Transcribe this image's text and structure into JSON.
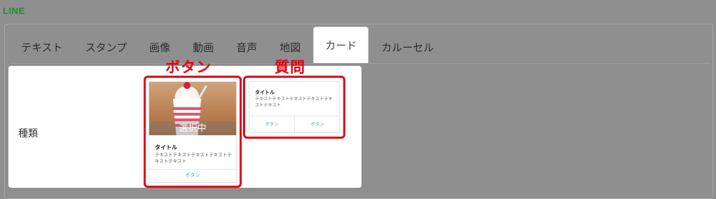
{
  "app": {
    "brand": "LINE"
  },
  "tabs": [
    {
      "label": "テキスト",
      "active": false
    },
    {
      "label": "スタンプ",
      "active": false
    },
    {
      "label": "画像",
      "active": false
    },
    {
      "label": "動画",
      "active": false
    },
    {
      "label": "音声",
      "active": false
    },
    {
      "label": "地図",
      "active": false
    },
    {
      "label": "カード",
      "active": true
    },
    {
      "label": "カルーセル",
      "active": false
    }
  ],
  "form": {
    "type_label": "種類"
  },
  "annotations": {
    "button": "ボタン",
    "question": "質問"
  },
  "button_card": {
    "selected_label": "選択中",
    "title": "タイトル",
    "body": "テキストテキストテキストテキストテキストテキスト",
    "button_label": "ボタン"
  },
  "question_card": {
    "title": "タイトル",
    "body": "テキストテキストテキストテキストテキストテキスト",
    "button_left": "ボタン",
    "button_right": "ボタン"
  },
  "colors": {
    "annotation_red": "#e60012",
    "brand_green": "#1a8f2a",
    "overlay_gray": "#8f8f8f"
  }
}
